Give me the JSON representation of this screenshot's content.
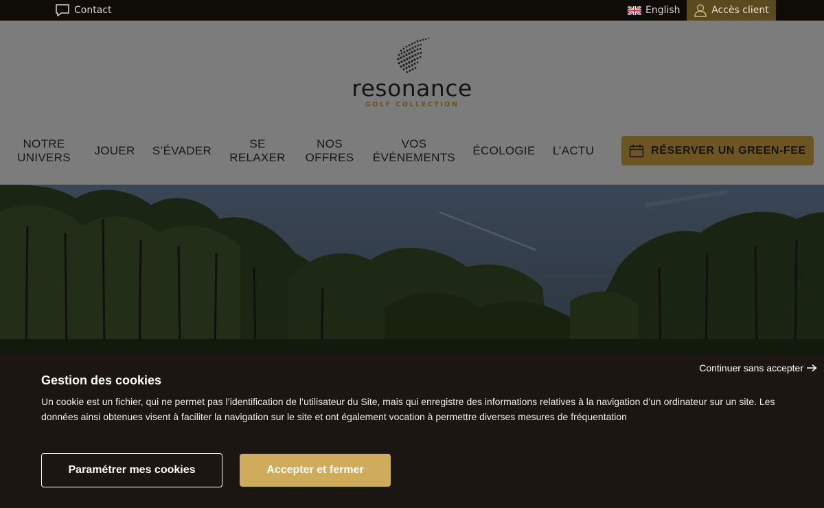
{
  "topbar": {
    "contact_label": "Contact",
    "language_label": "English",
    "client_label": "Accès client"
  },
  "brand": {
    "name": "resonance",
    "subtitle": "GOLF COLLECTION"
  },
  "nav": {
    "items": [
      {
        "line1": "NOTRE",
        "line2": "UNIVERS"
      },
      {
        "line1": "JOUER",
        "line2": ""
      },
      {
        "line1": "S’ÉVADER",
        "line2": ""
      },
      {
        "line1": "SE",
        "line2": "RELAXER"
      },
      {
        "line1": "NOS",
        "line2": "OFFRES"
      },
      {
        "line1": "VOS",
        "line2": "ÉVÉNEMENTS"
      },
      {
        "line1": "ÉCOLOGIE",
        "line2": ""
      },
      {
        "line1": "L’ACTU",
        "line2": ""
      }
    ],
    "reserve_label": "RÉSERVER UN GREEN-FEE"
  },
  "cookie": {
    "skip_label": "Continuer sans accepter",
    "title": "Gestion des cookies",
    "text": "Un cookie est un fichier, qui ne permet pas l’identification de l’utilisateur du Site, mais qui enregistre des informations relatives à la navigation d’un ordinateur sur un site. Les données ainsi obtenues visent à faciliter la navigation sur le site et ont également vocation à permettre diverses mesures de fréquentation",
    "settings_label": "Paramétrer mes cookies",
    "accept_label": "Accepter et fermer"
  },
  "icons": {
    "contact": "chat-bubble-icon",
    "language": "uk-flag-icon",
    "client": "user-icon",
    "reserve": "calendar-icon",
    "skip": "arrow-right-icon",
    "logo": "birds-flock-logo"
  },
  "colors": {
    "gold": "#cfac5b",
    "gold_dim": "#6c5523",
    "topbar": "#0f0b07",
    "banner": "#1b1612"
  }
}
